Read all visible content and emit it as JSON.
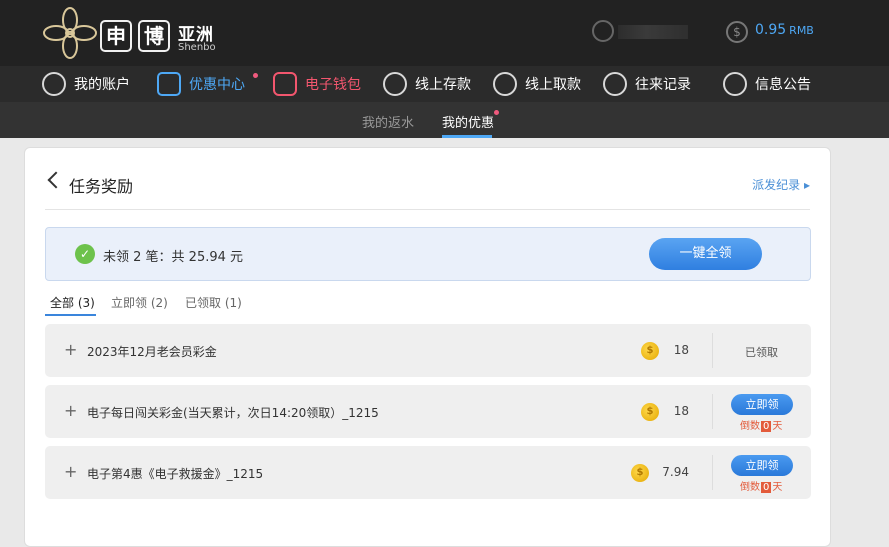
{
  "brand": {
    "char1": "申",
    "char2": "博",
    "cn_name": "亚洲",
    "en_name": "Shenbo"
  },
  "account": {
    "balance": "0.95",
    "currency": "RMB",
    "coin_symbol": "$"
  },
  "nav": {
    "items": [
      {
        "label": "我的账户",
        "icon": "user-icon"
      },
      {
        "label": "优惠中心",
        "icon": "gift-icon"
      },
      {
        "label": "电子钱包",
        "icon": "wallet-icon"
      },
      {
        "label": "线上存款",
        "icon": "deposit-icon"
      },
      {
        "label": "线上取款",
        "icon": "withdraw-icon"
      },
      {
        "label": "往来记录",
        "icon": "records-icon"
      },
      {
        "label": "信息公告",
        "icon": "bell-icon"
      }
    ]
  },
  "subnav": {
    "items": [
      "我的返水",
      "我的优惠"
    ]
  },
  "panel": {
    "title": "任务奖励",
    "history_link": "派发纪录 ▸",
    "summary": "未领 2 笔：共 25.94 元",
    "check_glyph": "✓",
    "claim_all": "一键全领",
    "tabs": [
      "全部 (3)",
      "立即领 (2)",
      "已领取 (1)"
    ],
    "rows": [
      {
        "name": "2023年12月老会员彩金",
        "amount": "18",
        "status": "已领取"
      },
      {
        "name": "电子每日闯关彩金(当天累计，次日14:20领取）_1215",
        "amount": "18",
        "button": "立即领",
        "countdown_prefix": "倒数",
        "countdown_num": "0",
        "countdown_suffix": "天"
      },
      {
        "name": "电子第4惠《电子救援金》_1215",
        "amount": "7.94",
        "button": "立即领",
        "countdown_prefix": "倒数",
        "countdown_num": "0",
        "countdown_suffix": "天"
      }
    ],
    "plus_glyph": "+",
    "coin_glyph": "$"
  }
}
